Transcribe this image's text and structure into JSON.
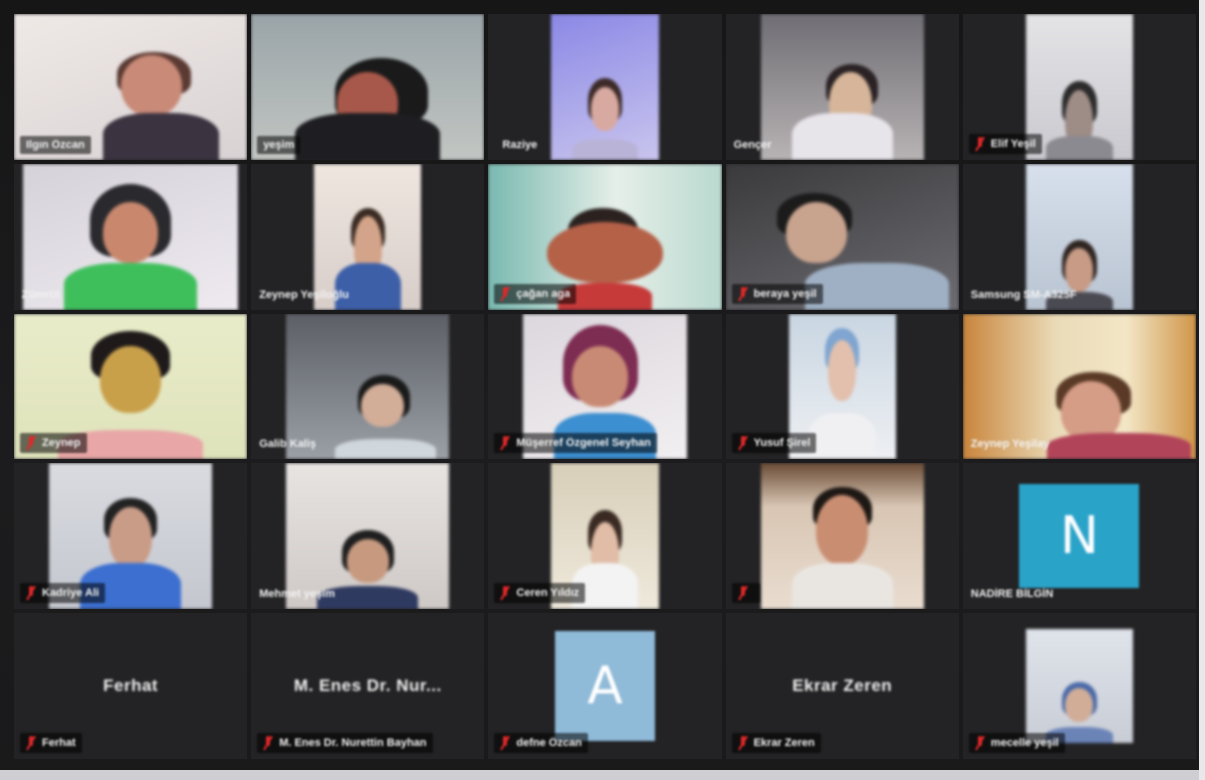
{
  "meeting": {
    "view": "gallery",
    "grid": "5x5",
    "participants": [
      {
        "name": "Ilgın Özcan",
        "muted": false,
        "video": true,
        "active_speaker": true
      },
      {
        "name": "yeşim",
        "muted": false,
        "video": true
      },
      {
        "name": "Raziye",
        "muted": false,
        "video": true
      },
      {
        "name": "Gençer",
        "muted": false,
        "video": true
      },
      {
        "name": "Elif Yeşil",
        "muted": true,
        "video": true
      },
      {
        "name": "Zümrüt",
        "muted": false,
        "video": true
      },
      {
        "name": "Zeynep Yeşiloğlu",
        "muted": false,
        "video": true
      },
      {
        "name": "çağan aga",
        "muted": true,
        "video": true
      },
      {
        "name": "beraya yeşil",
        "muted": true,
        "video": true
      },
      {
        "name": "Samsung SM-A325F",
        "muted": false,
        "video": true
      },
      {
        "name": "Zeynep",
        "muted": true,
        "video": true
      },
      {
        "name": "Galib Kaliş",
        "muted": false,
        "video": true
      },
      {
        "name": "Müşerref Özgenel Seyhan",
        "muted": true,
        "video": true
      },
      {
        "name": "Yusuf Şirel",
        "muted": true,
        "video": true
      },
      {
        "name": "Zeynep Yeşilay",
        "muted": false,
        "video": true
      },
      {
        "name": "Kadriye Ali",
        "muted": true,
        "video": true
      },
      {
        "name": "Mehmet yeşim",
        "muted": false,
        "video": true
      },
      {
        "name": "Ceren Yıldız",
        "muted": true,
        "video": true
      },
      {
        "name": "",
        "muted": true,
        "video": true
      },
      {
        "name": "NADİRE BİLGİN",
        "muted": false,
        "video": false,
        "avatar_letter": "N",
        "avatar_color": "#2aa3c9"
      },
      {
        "name": "Ferhat",
        "display_name": "Ferhat",
        "muted": true,
        "video": false
      },
      {
        "name": "M. Enes Dr. Nurettin Bayhan",
        "display_name": "M. Enes Dr. Nur...",
        "muted": true,
        "video": false
      },
      {
        "name": "defne Özcan",
        "muted": true,
        "video": false,
        "avatar_letter": "A",
        "avatar_color": "#8fbad8"
      },
      {
        "name": "Ekrar Zeren",
        "display_name": "Ekrar Zeren",
        "muted": true,
        "video": false
      },
      {
        "name": "mecelle yeşil",
        "muted": true,
        "video": true
      }
    ]
  },
  "colors": {
    "active_speaker_border": "#e3d21f",
    "muted_icon": "#e02828",
    "tile_background": "#232325"
  }
}
